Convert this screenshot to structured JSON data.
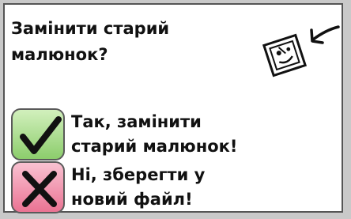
{
  "dialog": {
    "question_line1": "Замінити старий",
    "question_line2": "малюнок?",
    "icon": "picture-replace-icon"
  },
  "options": {
    "yes": {
      "line1": "Так, замінити",
      "line2": "старий малюнок!",
      "icon": "checkmark-icon",
      "color": "#8ccd6c"
    },
    "no": {
      "line1": "Ні, зберегти у",
      "line2": "новий файл!",
      "icon": "x-icon",
      "color": "#ea7393"
    }
  }
}
